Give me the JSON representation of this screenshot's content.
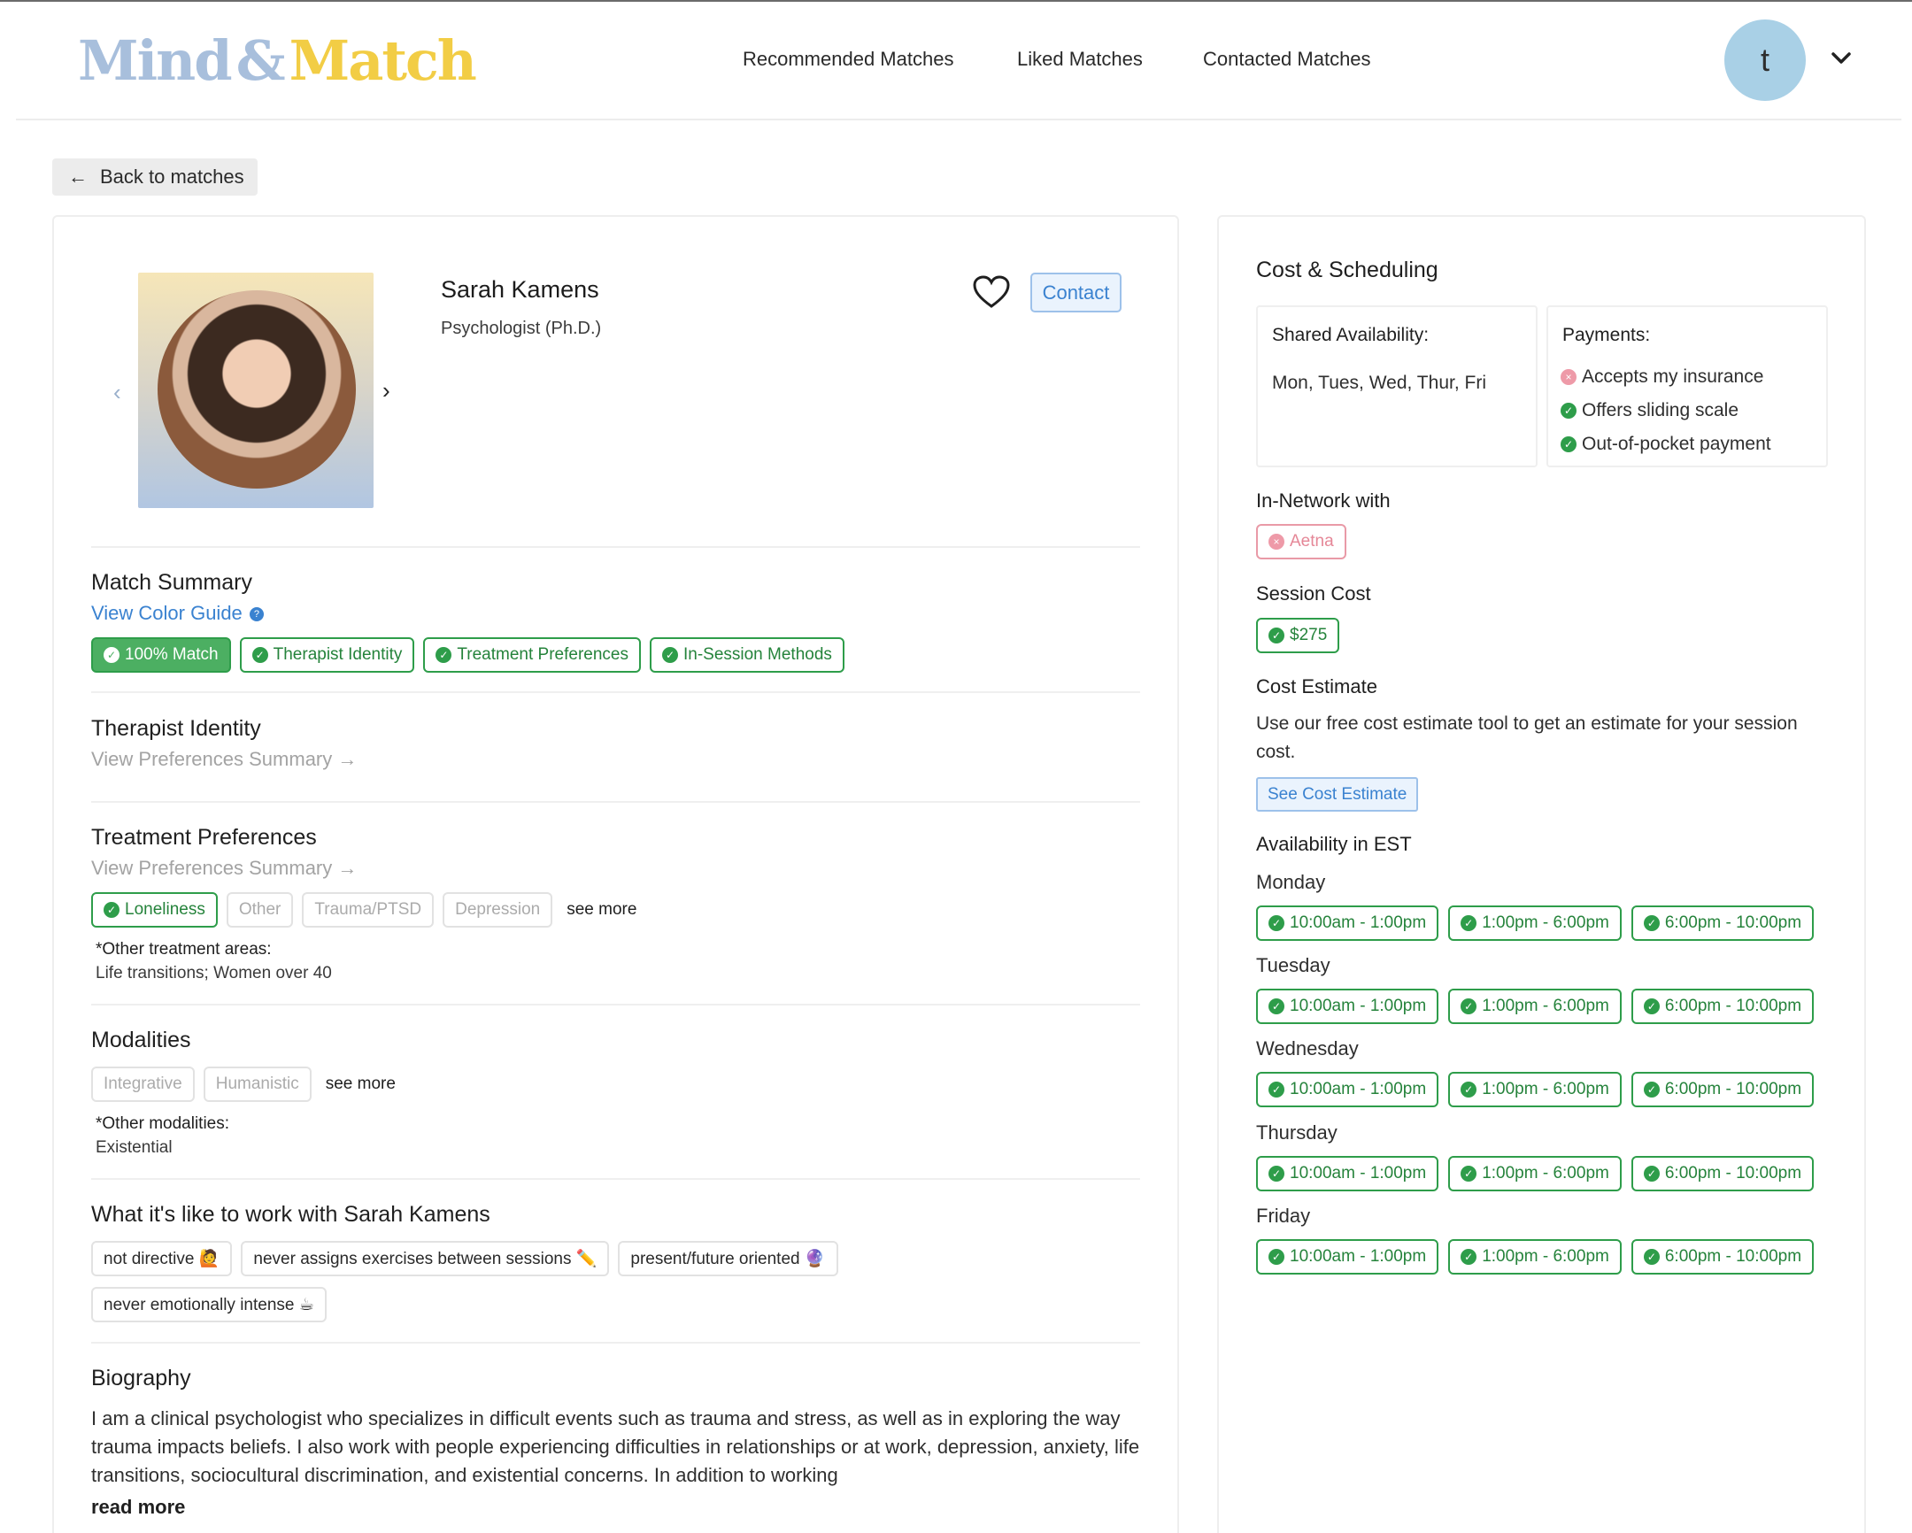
{
  "header": {
    "logo_mind": "Mind",
    "logo_amp": "&",
    "logo_match": "Match",
    "nav": [
      "Recommended Matches",
      "Liked Matches",
      "Contacted Matches"
    ],
    "avatar_initial": "t"
  },
  "back_label": "Back to matches",
  "profile": {
    "name": "Sarah Kamens",
    "title": "Psychologist (Ph.D.)",
    "contact_label": "Contact"
  },
  "match_summary": {
    "title": "Match Summary",
    "color_guide": "View Color Guide",
    "chips": [
      "100% Match",
      "Therapist Identity",
      "Treatment Preferences",
      "In-Session Methods"
    ]
  },
  "therapist_identity": {
    "title": "Therapist Identity",
    "link": "View Preferences Summary →"
  },
  "treatment_preferences": {
    "title": "Treatment Preferences",
    "link": "View Preferences Summary →",
    "chips": [
      "Loneliness",
      "Other",
      "Trauma/PTSD",
      "Depression"
    ],
    "see_more": "see more",
    "note_label": "*Other treatment areas:",
    "note_text": "Life transitions; Women over 40"
  },
  "modalities": {
    "title": "Modalities",
    "chips": [
      "Integrative",
      "Humanistic"
    ],
    "see_more": "see more",
    "note_label": "*Other modalities:",
    "note_text": "Existential"
  },
  "work_with": {
    "title": "What it's like to work with Sarah Kamens",
    "chips": [
      "not directive 🙋",
      "never assigns exercises between sessions ✏️",
      "present/future oriented 🔮",
      "never emotionally intense ☕"
    ]
  },
  "biography": {
    "title": "Biography",
    "text": "I am a clinical psychologist who specializes in difficult events such as trauma and stress, as well as in exploring the way trauma impacts beliefs. I also work with people experiencing difficulties in relationships or at work, depression, anxiety, life transitions, sociocultural discrimination, and existential concerns. In addition to working",
    "read_more": "read more"
  },
  "cost_scheduling": {
    "title": "Cost & Scheduling",
    "shared_availability_label": "Shared Availability:",
    "shared_availability_value": "Mon, Tues, Wed, Thur, Fri",
    "payments_label": "Payments:",
    "payments": [
      "Accepts my insurance",
      "Offers sliding scale",
      "Out-of-pocket payment"
    ],
    "in_network_label": "In-Network with",
    "in_network": "Aetna",
    "session_cost_label": "Session Cost",
    "session_cost": "$275",
    "cost_estimate_label": "Cost Estimate",
    "cost_estimate_text": "Use our free cost estimate tool to get an estimate for your session cost.",
    "cost_estimate_button": "See Cost Estimate",
    "availability_label": "Availability in EST",
    "days": [
      "Monday",
      "Tuesday",
      "Wednesday",
      "Thursday",
      "Friday"
    ],
    "slots": [
      "10:00am - 1:00pm",
      "1:00pm - 6:00pm",
      "6:00pm - 10:00pm"
    ]
  },
  "colors": {
    "green": "#2e9d4a",
    "blue": "#3a82d0",
    "red": "#e58797",
    "logo_blue": "#a8bfdc",
    "logo_yellow": "#f2cd45"
  }
}
